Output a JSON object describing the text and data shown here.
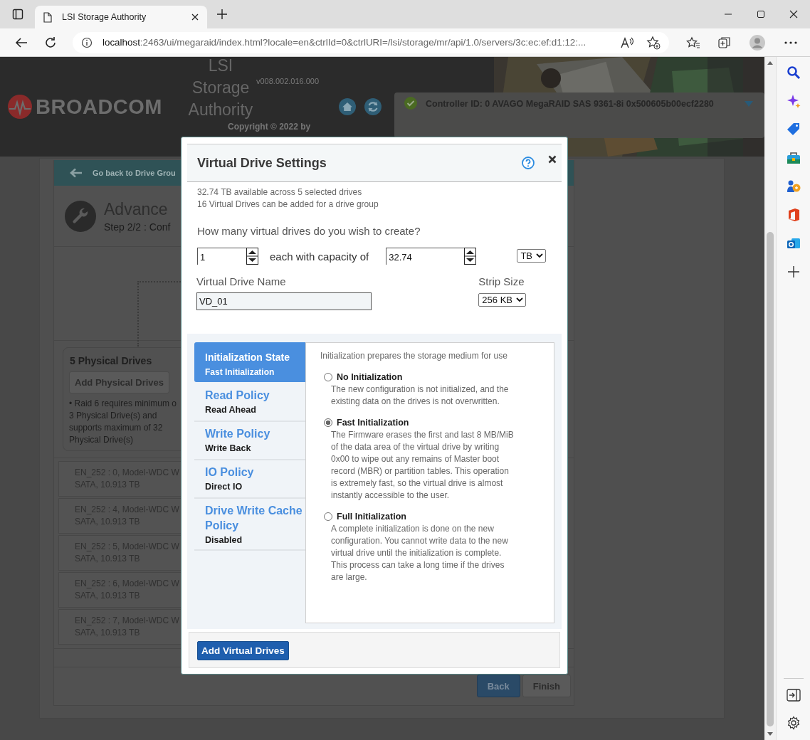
{
  "browser": {
    "tab_title": "LSI Storage Authority",
    "url_host": "localhost",
    "url_rest": ":2463/ui/megaraid/index.html?locale=en&ctrlId=0&ctrlURI=/lsi/storage/mr/api/1.0/servers/3c:ec:ef:d1:12:..."
  },
  "header": {
    "logo_text": "BROADCOM",
    "app_name": [
      "LSI",
      "Storage",
      "Authority"
    ],
    "version": "v008.002.016.000",
    "copyright": "Copyright © 2022 by",
    "controller": "Controller ID: 0 AVAGO MegaRAID SAS 9361-8i 0x500605b00ecf2280"
  },
  "page": {
    "back_link": "Go back to Drive Grou",
    "title": "Advance",
    "step": "Step 2/2 : Conf",
    "physical_panel": {
      "title": "5 Physical Drives",
      "add_button": {
        "label": "Add Physical Drives",
        "disabled": true
      },
      "note": [
        "• Raid 6 requires minimum o",
        "3 Physical Drive(s) and",
        "supports maximum of 32",
        "Physical Drive(s)"
      ]
    },
    "drives": [
      {
        "name": "EN_252 : 0, Model-WDC W",
        "detail": "SATA, 10.913 TB"
      },
      {
        "name": "EN_252 : 4, Model-WDC W",
        "detail": "SATA, 10.913 TB"
      },
      {
        "name": "EN_252 : 5, Model-WDC W",
        "detail": "SATA, 10.913 TB"
      },
      {
        "name": "EN_252 : 6, Model-WDC W",
        "detail": "SATA, 10.913 TB"
      },
      {
        "name": "EN_252 : 7, Model-WDC W",
        "detail": "SATA, 10.913 TB"
      }
    ],
    "buttons": [
      {
        "label": "Back",
        "disabled": false
      },
      {
        "label": "Finish",
        "disabled": true
      }
    ]
  },
  "modal": {
    "title": "Virtual Drive Settings",
    "info": [
      "32.74 TB available across 5 selected drives",
      "16 Virtual Drives can be added for a drive group"
    ],
    "question": "How many virtual drives do you wish to create?",
    "count": "1",
    "capacity_label": "each with capacity of",
    "capacity": "32.74",
    "unit": "TB",
    "name_label": "Virtual Drive Name",
    "name": "VD_01",
    "strip_label": "Strip Size",
    "strip_size": "256 KB",
    "tabs": [
      {
        "title": "Initialization State",
        "value": "Fast Initialization",
        "selected": true
      },
      {
        "title": "Read Policy",
        "value": "Read Ahead",
        "selected": false
      },
      {
        "title": "Write Policy",
        "value": "Write Back",
        "selected": false
      },
      {
        "title": "IO Policy",
        "value": "Direct IO",
        "selected": false
      },
      {
        "title": "Drive Write Cache Policy",
        "value": "Disabled",
        "selected": false
      }
    ],
    "description": "Initialization prepares the storage medium for use",
    "options": [
      {
        "label": "No Initialization",
        "description": "The new configuration is not initialized, and the existing data on the drives is not overwritten.",
        "selected": false
      },
      {
        "label": "Fast Initialization",
        "description": "The Firmware erases the first and last 8 MB/MiB of the data area of the virtual drive by writing 0x00 to wipe out any remains of Master boot record (MBR) or partition tables. This operation is extremely fast, so the virtual drive is almost instantly accessible to the user.",
        "selected": true
      },
      {
        "label": "Full Initialization",
        "description": "A complete initialization is done on the new configuration. You cannot write data to the new virtual drive until the initialization is complete. This process can take a long time if the drives are large.",
        "selected": false
      }
    ],
    "add_button": "Add Virtual Drives"
  }
}
